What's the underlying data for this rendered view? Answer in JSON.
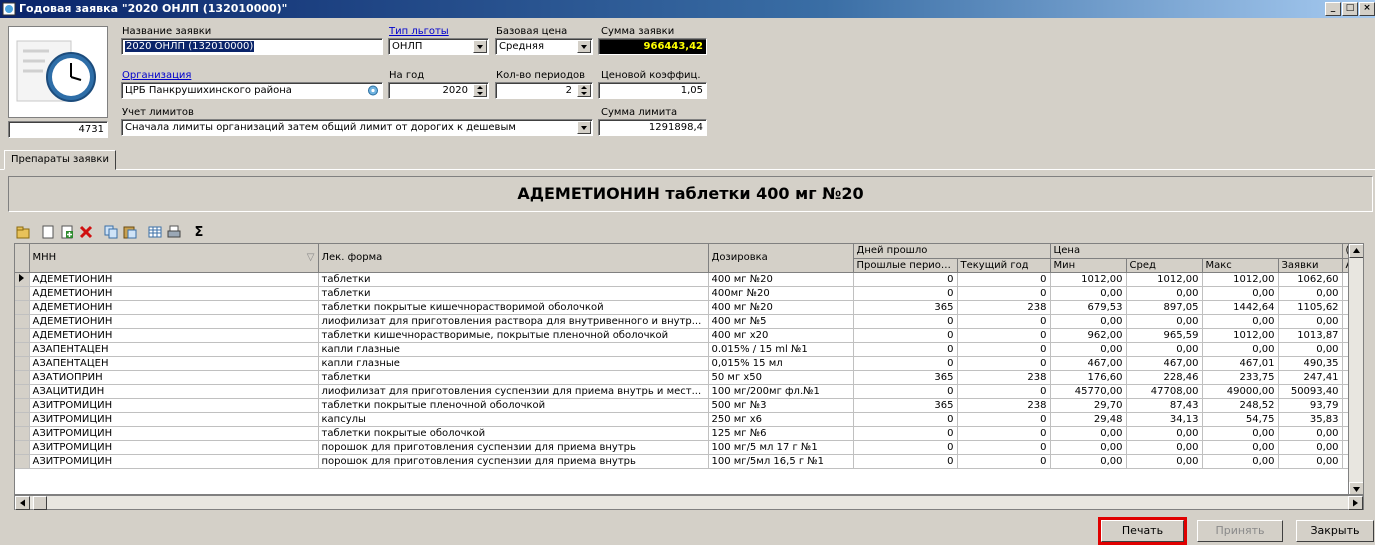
{
  "window": {
    "title": "Годовая заявка \"2020 ОНЛП (132010000)\""
  },
  "form": {
    "id_value": "4731",
    "name_label": "Название заявки",
    "name_value": "2020 ОНЛП (132010000)",
    "benefit_type_label": "Тип льготы",
    "benefit_type_value": "ОНЛП",
    "base_price_label": "Базовая цена",
    "base_price_value": "Средняя",
    "sum_label": "Сумма заявки",
    "sum_value": "966443,42",
    "org_label": "Организация",
    "org_value": "ЦРБ Панкрушихинского района",
    "year_label": "На год",
    "year_value": "2020",
    "periods_label": "Кол-во периодов",
    "periods_value": "2",
    "price_coef_label": "Ценовой коэффиц.",
    "price_coef_value": "1,05",
    "limits_label": "Учет лимитов",
    "limits_value": "Сначала лимиты организаций затем общий лимит от дорогих к дешевым",
    "limit_sum_label": "Сумма лимита",
    "limit_sum_value": "1291898,4"
  },
  "tabs": [
    {
      "label": "Препараты заявки"
    }
  ],
  "banner": "АДЕМЕТИОНИН таблетки 400 мг №20",
  "toolbar": {
    "icons": [
      "open-icon",
      "new-doc-icon",
      "add-doc-icon",
      "delete-icon",
      "copy-icon",
      "paste-icon",
      "table-icon",
      "print-icon",
      "sigma-icon"
    ],
    "sigma": "Σ"
  },
  "grid": {
    "headers": {
      "mnn": "МНН",
      "form": "Лек. форма",
      "dose": "Дозировка",
      "days_group": "Дней прошло",
      "days_past": "Прошлые периоды",
      "days_current": "Текущий год",
      "price_group": "Цена",
      "min": "Мин",
      "avg": "Сред",
      "max": "Макс",
      "req": "Заявки",
      "cut_group": "(",
      "cut_sub": "А"
    },
    "rows": [
      {
        "mnn": "АДЕМЕТИОНИН",
        "form": "таблетки",
        "dose": "400 мг №20",
        "past": "0",
        "cur": "0",
        "min": "1012,00",
        "avg": "1012,00",
        "max": "1012,00",
        "req": "1062,60"
      },
      {
        "mnn": "АДЕМЕТИОНИН",
        "form": "таблетки",
        "dose": "400мг №20",
        "past": "0",
        "cur": "0",
        "min": "0,00",
        "avg": "0,00",
        "max": "0,00",
        "req": "0,00"
      },
      {
        "mnn": "АДЕМЕТИОНИН",
        "form": "таблетки покрытые кишечнорастворимой оболочкой",
        "dose": "400 мг №20",
        "past": "365",
        "cur": "238",
        "min": "679,53",
        "avg": "897,05",
        "max": "1442,64",
        "req": "1105,62"
      },
      {
        "mnn": "АДЕМЕТИОНИН",
        "form": "лиофилизат для приготовления раствора для внутривенного и внутр...",
        "dose": "400 мг №5",
        "past": "0",
        "cur": "0",
        "min": "0,00",
        "avg": "0,00",
        "max": "0,00",
        "req": "0,00"
      },
      {
        "mnn": "АДЕМЕТИОНИН",
        "form": "таблетки кишечнорастворимые, покрытые пленочной оболочкой",
        "dose": "400 мг x20",
        "past": "0",
        "cur": "0",
        "min": "962,00",
        "avg": "965,59",
        "max": "1012,00",
        "req": "1013,87"
      },
      {
        "mnn": "АЗАПЕНТАЦЕН",
        "form": "капли глазные",
        "dose": "0.015% / 15 ml №1",
        "past": "0",
        "cur": "0",
        "min": "0,00",
        "avg": "0,00",
        "max": "0,00",
        "req": "0,00"
      },
      {
        "mnn": "АЗАПЕНТАЦЕН",
        "form": "капли глазные",
        "dose": "0,015% 15 мл",
        "past": "0",
        "cur": "0",
        "min": "467,00",
        "avg": "467,00",
        "max": "467,01",
        "req": "490,35"
      },
      {
        "mnn": "АЗАТИОПРИН",
        "form": "таблетки",
        "dose": "50 мг x50",
        "past": "365",
        "cur": "238",
        "min": "176,60",
        "avg": "228,46",
        "max": "233,75",
        "req": "247,41"
      },
      {
        "mnn": "АЗАЦИТИДИН",
        "form": "лиофилизат для приготовления суспензии для приема внутрь и мест...",
        "dose": "100 мг/200мг фл.№1",
        "past": "0",
        "cur": "0",
        "min": "45770,00",
        "avg": "47708,00",
        "max": "49000,00",
        "req": "50093,40"
      },
      {
        "mnn": "АЗИТРОМИЦИН",
        "form": "таблетки покрытые пленочной оболочкой",
        "dose": "500 мг №3",
        "past": "365",
        "cur": "238",
        "min": "29,70",
        "avg": "87,43",
        "max": "248,52",
        "req": "93,79"
      },
      {
        "mnn": "АЗИТРОМИЦИН",
        "form": "капсулы",
        "dose": "250 мг x6",
        "past": "0",
        "cur": "0",
        "min": "29,48",
        "avg": "34,13",
        "max": "54,75",
        "req": "35,83"
      },
      {
        "mnn": "АЗИТРОМИЦИН",
        "form": "таблетки покрытые оболочкой",
        "dose": "125 мг №6",
        "past": "0",
        "cur": "0",
        "min": "0,00",
        "avg": "0,00",
        "max": "0,00",
        "req": "0,00"
      },
      {
        "mnn": "АЗИТРОМИЦИН",
        "form": "порошок для приготовления суспензии для приема внутрь",
        "dose": "100 мг/5 мл 17 г №1",
        "past": "0",
        "cur": "0",
        "min": "0,00",
        "avg": "0,00",
        "max": "0,00",
        "req": "0,00"
      },
      {
        "mnn": "АЗИТРОМИЦИН",
        "form": "порошок для приготовления суспензии для приема внутрь",
        "dose": "100 мг/5мл 16,5 г №1",
        "past": "0",
        "cur": "0",
        "min": "0,00",
        "avg": "0,00",
        "max": "0,00",
        "req": "0,00"
      }
    ]
  },
  "buttons": {
    "print": "Печать",
    "accept": "Принять",
    "close": "Закрыть"
  },
  "colors": {
    "highlight": "#e00000",
    "sum_bg": "#000000",
    "sum_fg": "#ffff00"
  }
}
